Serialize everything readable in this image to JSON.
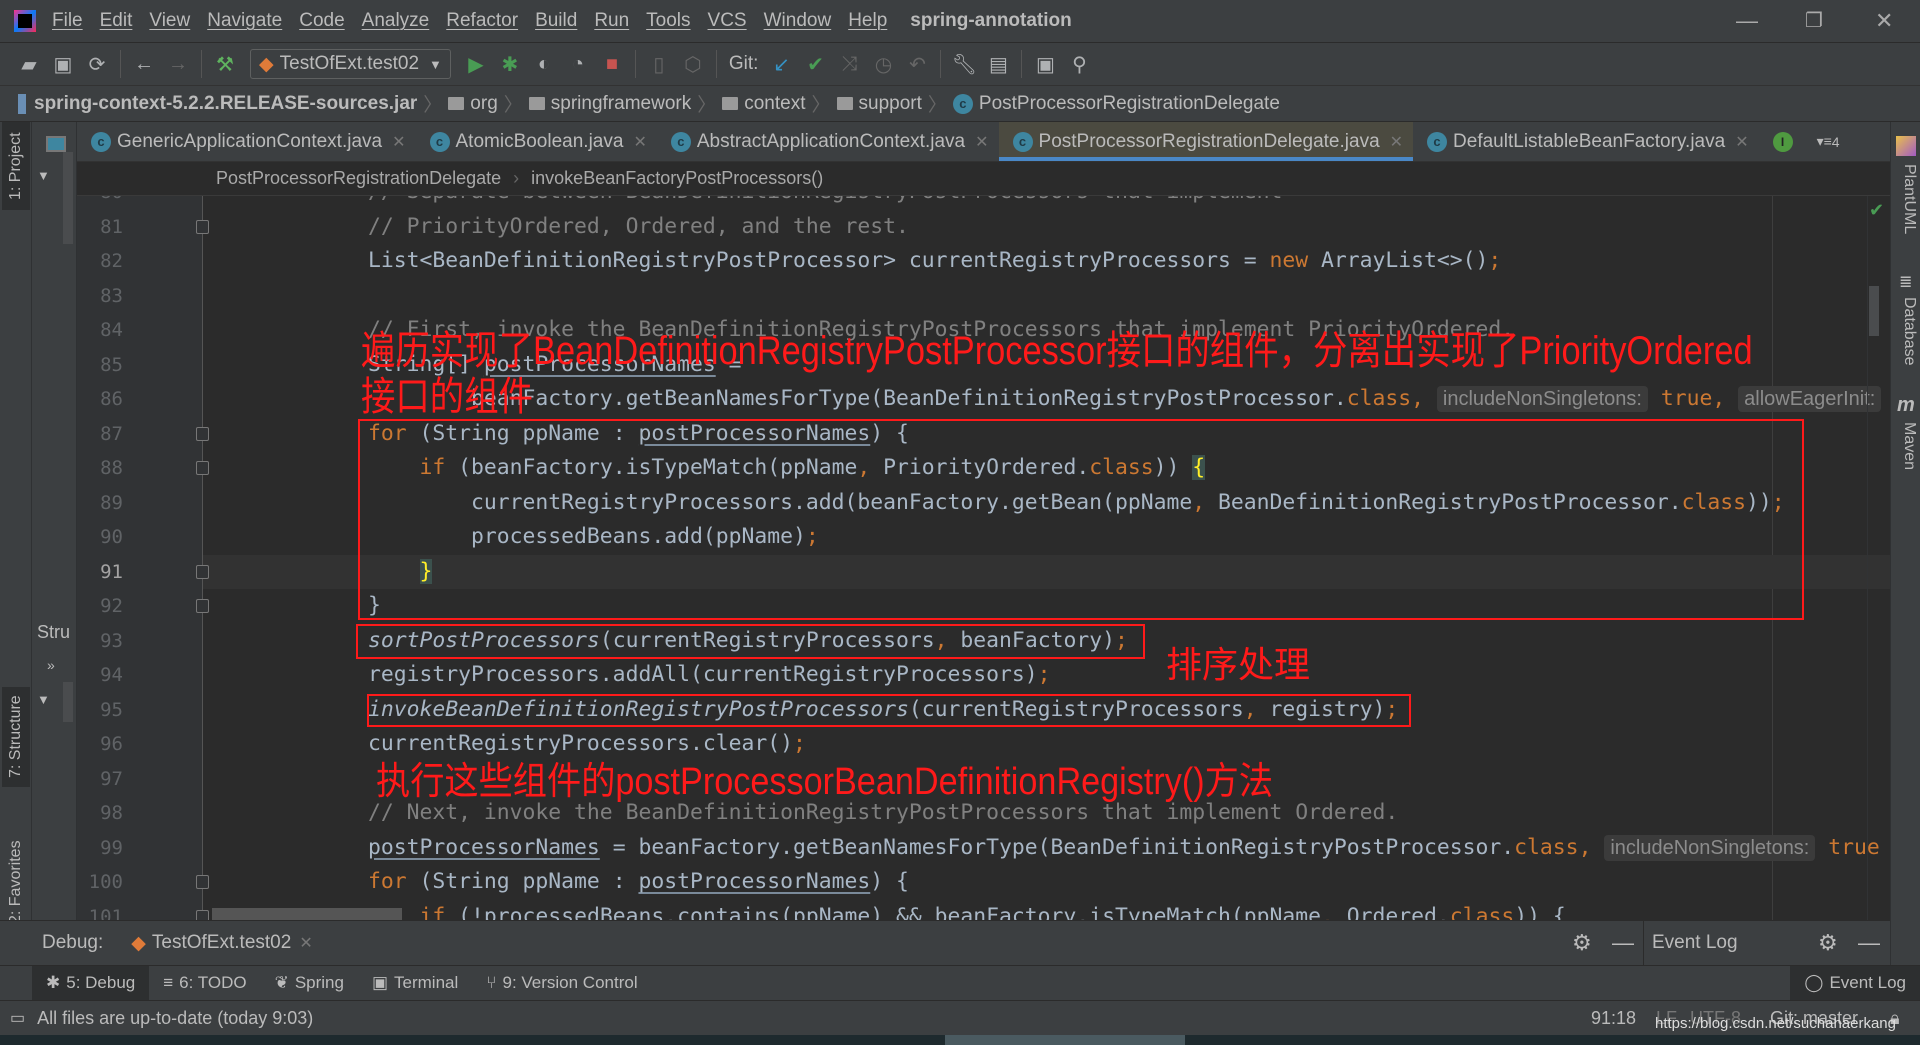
{
  "menu": [
    "File",
    "Edit",
    "View",
    "Navigate",
    "Code",
    "Analyze",
    "Refactor",
    "Build",
    "Run",
    "Tools",
    "VCS",
    "Window",
    "Help"
  ],
  "app_title": "spring-annotation",
  "toolbar": {
    "run_config": "TestOfExt.test02",
    "git_label": "Git:"
  },
  "nav": [
    "spring-context-5.2.2.RELEASE-sources.jar",
    "org",
    "springframework",
    "context",
    "support",
    "PostProcessorRegistrationDelegate"
  ],
  "tabs": [
    {
      "label": "GenericApplicationContext.java",
      "active": false
    },
    {
      "label": "AtomicBoolean.java",
      "active": false
    },
    {
      "label": "AbstractApplicationContext.java",
      "active": false
    },
    {
      "label": "PostProcessorRegistrationDelegate.java",
      "active": true
    },
    {
      "label": "DefaultListableBeanFactory.java",
      "active": false
    }
  ],
  "tab_overflow": "4",
  "breadcrumb": [
    "PostProcessorRegistrationDelegate",
    "invokeBeanFactoryPostProcessors()"
  ],
  "left_tools": {
    "project": "1: Project",
    "structure": "7: Structure",
    "favorites": "2: Favorites",
    "structure_panel": "Stru"
  },
  "right_tools": [
    "PlantUML",
    "Database",
    "Maven"
  ],
  "current_line": 91,
  "code": [
    {
      "n": 80,
      "t": [
        [
          "// Separate between BeanDefinitionRegistryPostProcessors that implement",
          "c"
        ]
      ]
    },
    {
      "n": 81,
      "t": [
        [
          "// PriorityOrdered, Ordered, and the rest.",
          "c"
        ]
      ]
    },
    {
      "n": 82,
      "t": [
        [
          "List<BeanDefinitionRegistryPostProcessor> currentRegistryProcessors = ",
          ""
        ],
        [
          "new",
          "k"
        ],
        [
          " ArrayList<>()",
          ""
        ],
        [
          ";",
          "p"
        ]
      ]
    },
    {
      "n": 83,
      "t": []
    },
    {
      "n": 84,
      "t": [
        [
          "// First, invoke the BeanDefinitionRegistryPostProcessors that implement PriorityOrdered.",
          "c"
        ]
      ]
    },
    {
      "n": 85,
      "t": [
        [
          "String[] ",
          ""
        ],
        [
          "postProcessorNames",
          "u"
        ],
        [
          " =",
          ""
        ]
      ]
    },
    {
      "n": 86,
      "t": [
        [
          "        beanFactory.getBeanNamesForType(BeanDefinitionRegistryPostProcessor.",
          ""
        ],
        [
          "class",
          "k"
        ],
        [
          ", ",
          "p"
        ],
        [
          "includeNonSingletons:",
          "h"
        ],
        [
          " ",
          ""
        ],
        [
          "true",
          "k"
        ],
        [
          ", ",
          "p"
        ],
        [
          "allowEagerInit:",
          "h"
        ]
      ]
    },
    {
      "n": 87,
      "t": [
        [
          "for",
          "k"
        ],
        [
          " (String ppName : ",
          ""
        ],
        [
          "postProcessorNames",
          "u"
        ],
        [
          ") {",
          ""
        ]
      ]
    },
    {
      "n": 88,
      "t": [
        [
          "    ",
          ""
        ],
        [
          "if",
          "k"
        ],
        [
          " (beanFactory.isTypeMatch(ppName",
          ""
        ],
        [
          ", ",
          "p"
        ],
        [
          "PriorityOrdered.",
          ""
        ],
        [
          "class",
          "k"
        ],
        [
          ")) ",
          ""
        ],
        [
          "{",
          "br"
        ]
      ]
    },
    {
      "n": 89,
      "t": [
        [
          "        currentRegistryProcessors.add(beanFactory.getBean(ppName",
          ""
        ],
        [
          ", ",
          "p"
        ],
        [
          "BeanDefinitionRegistryPostProcessor.",
          ""
        ],
        [
          "class",
          "k"
        ],
        [
          "))",
          ""
        ],
        [
          ";",
          "p"
        ]
      ]
    },
    {
      "n": 90,
      "t": [
        [
          "        processedBeans.add(ppName)",
          ""
        ],
        [
          ";",
          "p"
        ]
      ]
    },
    {
      "n": 91,
      "t": [
        [
          "    ",
          ""
        ],
        [
          "}",
          "br"
        ]
      ]
    },
    {
      "n": 92,
      "t": [
        [
          "}",
          ""
        ]
      ]
    },
    {
      "n": 93,
      "t": [
        [
          "sortPostProcessors",
          "i"
        ],
        [
          "(currentRegistryProcessors",
          ""
        ],
        [
          ", ",
          "p"
        ],
        [
          "beanFactory)",
          ""
        ],
        [
          ";",
          "p"
        ]
      ]
    },
    {
      "n": 94,
      "t": [
        [
          "registryProcessors.addAll(currentRegistryProcessors)",
          ""
        ],
        [
          ";",
          "p"
        ]
      ]
    },
    {
      "n": 95,
      "t": [
        [
          "invokeBeanDefinitionRegistryPostProcessors",
          "i"
        ],
        [
          "(currentRegistryProcessors",
          ""
        ],
        [
          ", ",
          "p"
        ],
        [
          "registry)",
          ""
        ],
        [
          ";",
          "p"
        ]
      ]
    },
    {
      "n": 96,
      "t": [
        [
          "currentRegistryProcessors.clear()",
          ""
        ],
        [
          ";",
          "p"
        ]
      ]
    },
    {
      "n": 97,
      "t": []
    },
    {
      "n": 98,
      "t": [
        [
          "// Next, invoke the BeanDefinitionRegistryPostProcessors that implement Ordered.",
          "c"
        ]
      ]
    },
    {
      "n": 99,
      "t": [
        [
          "postProcessorNames",
          "u"
        ],
        [
          " = beanFactory.getBeanNamesForType(BeanDefinitionRegistryPostProcessor.",
          ""
        ],
        [
          "class",
          "k"
        ],
        [
          ", ",
          "p"
        ],
        [
          "includeNonSingletons:",
          "h"
        ],
        [
          " true",
          "k"
        ]
      ]
    },
    {
      "n": 100,
      "t": [
        [
          "for",
          "k"
        ],
        [
          " (String ppName : ",
          ""
        ],
        [
          "postProcessorNames",
          "u"
        ],
        [
          ") {",
          ""
        ]
      ]
    },
    {
      "n": 101,
      "t": [
        [
          "    ",
          ""
        ],
        [
          "if",
          "k"
        ],
        [
          " (!processedBeans.contains(ppName) && beanFactory.isTypeMatch(ppName",
          ""
        ],
        [
          ", ",
          "p"
        ],
        [
          "Ordered.",
          ""
        ],
        [
          "class",
          "k"
        ],
        [
          ")) {",
          ""
        ]
      ]
    }
  ],
  "annotations": {
    "note1_line1": "遍历实现了BeanDefinitionRegistryPostProcessor接口的组件，分离出实现了PriorityOrdered",
    "note1_line2": "接口的组件",
    "note2": "排序处理",
    "note3": "执行这些组件的postProcessorBeanDefinitionRegistry()方法",
    "color": "#ff1a1a"
  },
  "debug": {
    "label": "Debug:",
    "session": "TestOfExt.test02",
    "event_log": "Event Log"
  },
  "tool_windows": [
    "5: Debug",
    "6: TODO",
    "Spring",
    "Terminal",
    "9: Version Control"
  ],
  "tool_windows_right": "Event Log",
  "status": {
    "message": "All files are up-to-date (today 9:03)",
    "position": "91:18",
    "line_sep": "LF",
    "encoding": "UTF-8",
    "vcs": "Git: master"
  },
  "watermark": "https://blog.csdn.net/suchahaerkang"
}
